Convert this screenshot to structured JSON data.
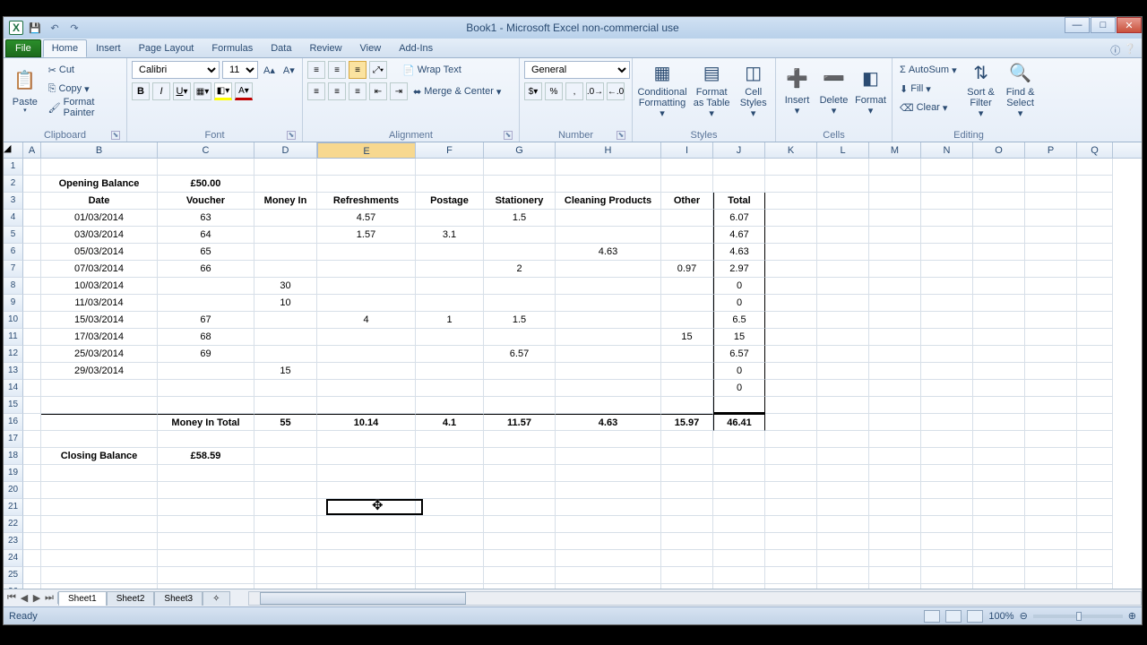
{
  "title": "Book1 - Microsoft Excel non-commercial use",
  "tabs": {
    "file": "File",
    "home": "Home",
    "insert": "Insert",
    "pagelayout": "Page Layout",
    "formulas": "Formulas",
    "data": "Data",
    "review": "Review",
    "view": "View",
    "addins": "Add-Ins"
  },
  "ribbon": {
    "clipboard": {
      "paste": "Paste",
      "cut": "Cut",
      "copy": "Copy",
      "fmt": "Format Painter",
      "label": "Clipboard"
    },
    "font": {
      "name": "Calibri",
      "size": "11",
      "label": "Font"
    },
    "alignment": {
      "wrap": "Wrap Text",
      "merge": "Merge & Center",
      "label": "Alignment"
    },
    "number": {
      "fmt": "General",
      "label": "Number"
    },
    "styles": {
      "cond": "Conditional Formatting",
      "ft": "Format as Table",
      "cs": "Cell Styles",
      "label": "Styles"
    },
    "cells": {
      "insert": "Insert",
      "delete": "Delete",
      "format": "Format",
      "label": "Cells"
    },
    "editing": {
      "sum": "AutoSum",
      "fill": "Fill",
      "clear": "Clear",
      "sort": "Sort & Filter",
      "find": "Find & Select",
      "label": "Editing"
    }
  },
  "cols": [
    "A",
    "B",
    "C",
    "D",
    "E",
    "F",
    "G",
    "H",
    "I",
    "J",
    "K",
    "L",
    "M",
    "N",
    "O",
    "P",
    "Q"
  ],
  "sheet": {
    "r2": {
      "B": "Opening Balance",
      "C": "£50.00"
    },
    "r3": {
      "B": "Date",
      "C": "Voucher",
      "D": "Money In",
      "E": "Refreshments",
      "F": "Postage",
      "G": "Stationery",
      "H": "Cleaning Products",
      "I": "Other",
      "J": "Total"
    },
    "r4": {
      "B": "01/03/2014",
      "C": "63",
      "E": "4.57",
      "G": "1.5",
      "J": "6.07"
    },
    "r5": {
      "B": "03/03/2014",
      "C": "64",
      "E": "1.57",
      "F": "3.1",
      "J": "4.67"
    },
    "r6": {
      "B": "05/03/2014",
      "C": "65",
      "H": "4.63",
      "J": "4.63"
    },
    "r7": {
      "B": "07/03/2014",
      "C": "66",
      "G": "2",
      "I": "0.97",
      "J": "2.97"
    },
    "r8": {
      "B": "10/03/2014",
      "D": "30",
      "J": "0"
    },
    "r9": {
      "B": "11/03/2014",
      "D": "10",
      "J": "0"
    },
    "r10": {
      "B": "15/03/2014",
      "C": "67",
      "E": "4",
      "F": "1",
      "G": "1.5",
      "J": "6.5"
    },
    "r11": {
      "B": "17/03/2014",
      "C": "68",
      "I": "15",
      "J": "15"
    },
    "r12": {
      "B": "25/03/2014",
      "C": "69",
      "G": "6.57",
      "J": "6.57"
    },
    "r13": {
      "B": "29/03/2014",
      "D": "15",
      "J": "0"
    },
    "r14": {
      "J": "0"
    },
    "r16": {
      "C": "Money In Total",
      "D": "55",
      "E": "10.14",
      "F": "4.1",
      "G": "11.57",
      "H": "4.63",
      "I": "15.97",
      "J": "46.41"
    },
    "r18": {
      "B": "Closing Balance",
      "C": "£58.59"
    }
  },
  "sheets": {
    "s1": "Sheet1",
    "s2": "Sheet2",
    "s3": "Sheet3"
  },
  "status": {
    "ready": "Ready",
    "zoom": "100%"
  }
}
